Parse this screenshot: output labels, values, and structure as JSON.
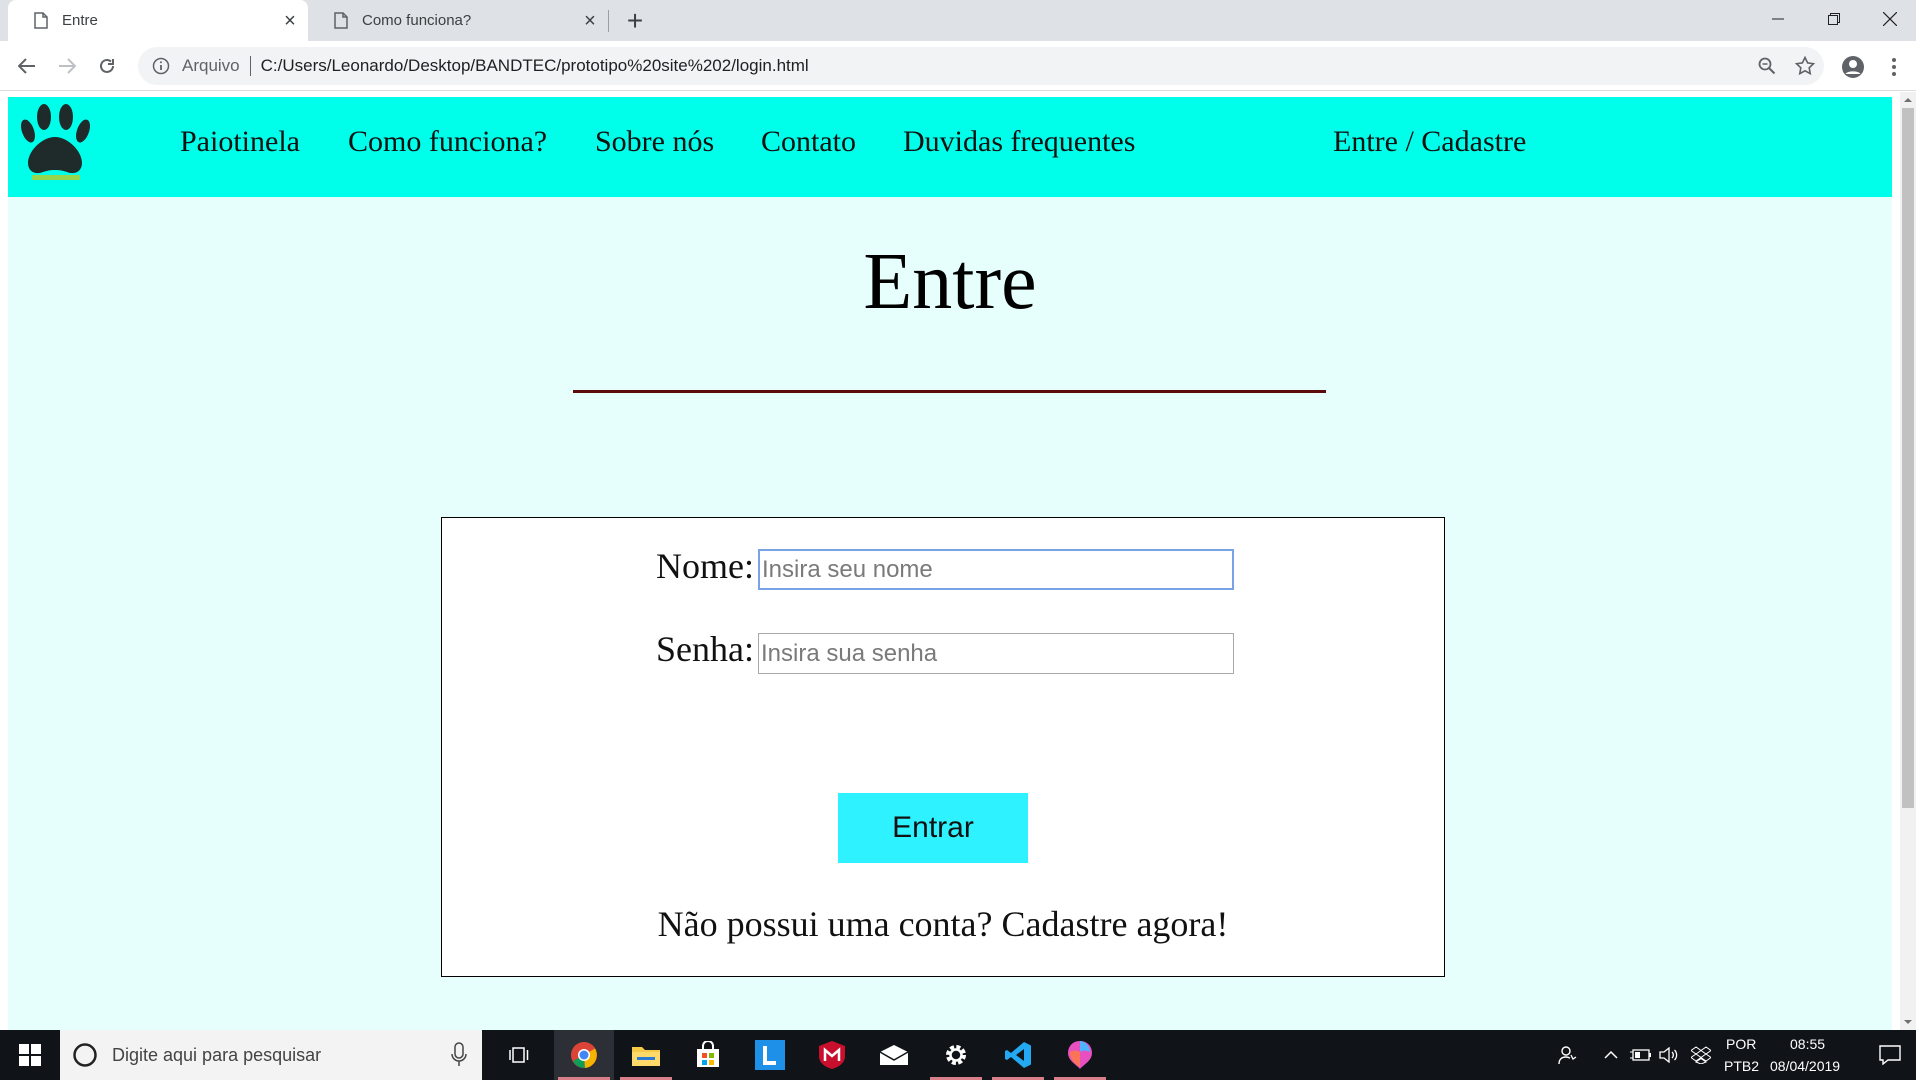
{
  "browser": {
    "tabs": [
      {
        "title": "Entre",
        "active": true
      },
      {
        "title": "Como funciona?",
        "active": false
      }
    ],
    "address": {
      "scheme_label": "Arquivo",
      "url": "C:/Users/Leonardo/Desktop/BANDTEC/prototipo%20site%202/login.html"
    }
  },
  "site": {
    "nav": {
      "links": [
        "Paiotinela",
        "Como funciona?",
        "Sobre nós",
        "Contato",
        "Duvidas frequentes"
      ],
      "account_link": "Entre / Cadastre"
    },
    "page_title": "Entre",
    "form": {
      "name_label": "Nome:",
      "name_placeholder": "Insira seu nome",
      "password_label": "Senha:",
      "password_placeholder": "Insira sua senha",
      "submit_label": "Entrar",
      "signup_text": "Não possui uma conta? Cadastre agora!"
    },
    "colors": {
      "nav_bg": "#00ffea",
      "page_bg": "#e6fffd",
      "button_bg": "#2ef2ff",
      "rule": "#5c0a0a"
    }
  },
  "taskbar": {
    "search_placeholder": "Digite aqui para pesquisar",
    "apps": [
      "chrome-icon",
      "file-explorer-icon",
      "store-icon",
      "l-app-icon",
      "mcafee-icon",
      "mail-icon",
      "settings-icon",
      "vscode-icon",
      "paint3d-icon"
    ],
    "tray": {
      "language_top": "POR",
      "language_bottom": "PTB2",
      "time": "08:55",
      "date": "08/04/2019"
    }
  }
}
